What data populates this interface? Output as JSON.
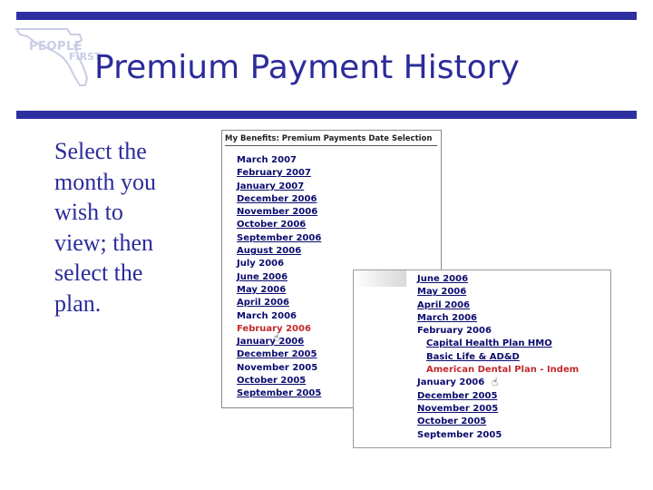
{
  "slide": {
    "title": "Premium Payment History",
    "body": "Select the month you wish to view; then select the plan.",
    "logo": {
      "text_top": "PEOPLE",
      "text_bottom": "FIRST"
    },
    "bar_color": "#2e2fa0",
    "title_color": "#2b2b9b"
  },
  "screenshot1": {
    "header": "My Benefits: Premium Payments Date Selection",
    "months": [
      {
        "label": "March 2007",
        "style": "plain"
      },
      {
        "label": "February 2007",
        "style": "link"
      },
      {
        "label": "January 2007",
        "style": "link"
      },
      {
        "label": "December 2006",
        "style": "link"
      },
      {
        "label": "November 2006",
        "style": "link"
      },
      {
        "label": "October 2006",
        "style": "link"
      },
      {
        "label": "September 2006",
        "style": "link"
      },
      {
        "label": "August 2006",
        "style": "link"
      },
      {
        "label": "July 2006",
        "style": "plain"
      },
      {
        "label": "June 2006",
        "style": "link"
      },
      {
        "label": "May 2006",
        "style": "link"
      },
      {
        "label": "April 2006",
        "style": "link"
      },
      {
        "label": "March 2006",
        "style": "plain"
      },
      {
        "label": "February 2006",
        "style": "active"
      },
      {
        "label": "January 2006",
        "style": "link"
      },
      {
        "label": "December 2005",
        "style": "link"
      },
      {
        "label": "November 2005",
        "style": "plain"
      },
      {
        "label": "October 2005",
        "style": "link"
      },
      {
        "label": "September 2005",
        "style": "link"
      }
    ]
  },
  "screenshot2": {
    "months_before": [
      {
        "label": "June 2006",
        "style": "link"
      },
      {
        "label": "May 2006",
        "style": "link"
      },
      {
        "label": "April 2006",
        "style": "link"
      },
      {
        "label": "March 2006",
        "style": "link"
      },
      {
        "label": "February 2006",
        "style": "plain"
      }
    ],
    "plans": [
      {
        "label": "Capital Health Plan HMO",
        "style": "link"
      },
      {
        "label": "Basic Life & AD&D",
        "style": "link"
      },
      {
        "label": "American Dental Plan - Indem",
        "style": "active"
      }
    ],
    "months_after": [
      {
        "label": "January 2006",
        "style": "plain"
      },
      {
        "label": "December 2005",
        "style": "link"
      },
      {
        "label": "November 2005",
        "style": "link"
      },
      {
        "label": "October 2005",
        "style": "link"
      },
      {
        "label": "September 2005",
        "style": "plain"
      }
    ]
  }
}
